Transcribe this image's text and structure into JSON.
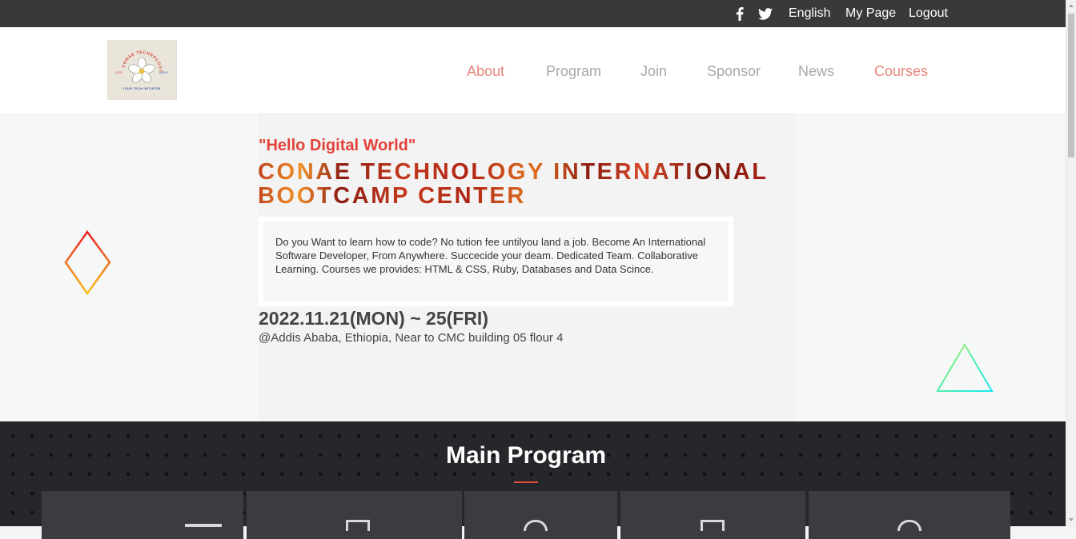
{
  "topbar": {
    "social": [
      "facebook-icon",
      "twitter-icon"
    ],
    "links": {
      "language": "English",
      "my_page": "My Page",
      "logout": "Logout"
    }
  },
  "header": {
    "logo": {
      "line1": "CONAE TECHNOLOGY",
      "left_text": "2022",
      "right_text": "MCKY",
      "tagline": "YOUR TECH INITIATOR"
    },
    "nav": [
      {
        "label": "About",
        "active": false
      },
      {
        "label": "Program",
        "active": false
      },
      {
        "label": "Join",
        "active": false
      },
      {
        "label": "Sponsor",
        "active": false
      },
      {
        "label": "News",
        "active": false
      },
      {
        "label": "Courses",
        "active": true
      }
    ]
  },
  "hero": {
    "greeting": "\"Hello Digital World\"",
    "title": "CONAE TECHNOLOGY INTERNATIONAL BOOTCAMP CENTER",
    "description": "Do you Want to learn how to code? No tution fee untilyou land a job. Become An International Software Developer, From Anywhere. Succecide your deam. Dedicated Team. Collaborative Learning. Courses we provides: HTML & CSS, Ruby, Databases and Data Scince.",
    "date": "2022.11.21(MON) ~ 25(FRI)",
    "venue": "@Addis Ababa, Ethiopia, Near to CMC building 05 flour 4"
  },
  "program": {
    "title": "Main Program",
    "cards": [
      "card-1",
      "card-2",
      "card-3",
      "card-4",
      "card-5"
    ]
  },
  "colors": {
    "topbar_bg": "#393939",
    "accent_red": "#e3433a",
    "nav_accent": "#e8857a",
    "nav_indicator": "#f5c518",
    "program_bg": "#26272b"
  }
}
